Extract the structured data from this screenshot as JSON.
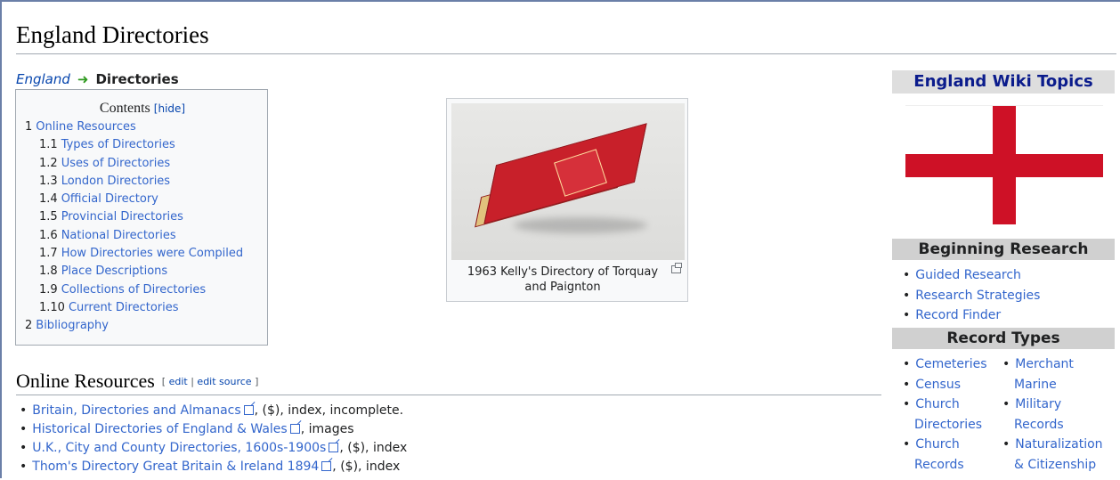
{
  "page": {
    "title": "England Directories",
    "breadcrumb": {
      "parent": "England",
      "current": "Directories"
    }
  },
  "toc": {
    "title": "Contents",
    "hide_label": "hide",
    "items": [
      {
        "num": "1",
        "label": "Online Resources",
        "level": 1
      },
      {
        "num": "1.1",
        "label": "Types of Directories",
        "level": 2
      },
      {
        "num": "1.2",
        "label": "Uses of Directories",
        "level": 2
      },
      {
        "num": "1.3",
        "label": "London Directories",
        "level": 2
      },
      {
        "num": "1.4",
        "label": "Official Directory",
        "level": 2
      },
      {
        "num": "1.5",
        "label": "Provincial Directories",
        "level": 2
      },
      {
        "num": "1.6",
        "label": "National Directories",
        "level": 2
      },
      {
        "num": "1.7",
        "label": "How Directories were Compiled",
        "level": 2
      },
      {
        "num": "1.8",
        "label": "Place Descriptions",
        "level": 2
      },
      {
        "num": "1.9",
        "label": "Collections of Directories",
        "level": 2
      },
      {
        "num": "1.10",
        "label": "Current Directories",
        "level": 2
      },
      {
        "num": "2",
        "label": "Bibliography",
        "level": 1
      }
    ]
  },
  "thumbnail": {
    "caption": "1963 Kelly's Directory of Torquay and Paignton",
    "icon": "magnify-icon"
  },
  "section": {
    "heading": "Online Resources",
    "edit_label": "edit",
    "edit_source_label": "edit source"
  },
  "resources": [
    {
      "link": "Britain, Directories and Almanacs",
      "suffix": ", ($), index, incomplete."
    },
    {
      "link": "Historical Directories of England & Wales",
      "suffix": ", images"
    },
    {
      "link": "U.K., City and County Directories, 1600s-1900s",
      "suffix": ", ($), index"
    },
    {
      "link": "Thom's Directory Great Britain & Ireland 1894",
      "suffix": ", ($), index"
    }
  ],
  "sidebar": {
    "title": "England Wiki Topics",
    "flag_colors": {
      "field": "#ffffff",
      "cross": "#ce1126"
    },
    "beginning_research": {
      "heading": "Beginning Research",
      "items": [
        "Guided Research",
        "Research Strategies",
        "Record Finder"
      ]
    },
    "record_types": {
      "heading": "Record Types",
      "col1": [
        {
          "line1": "Cemeteries",
          "line2": ""
        },
        {
          "line1": "Census",
          "line2": ""
        },
        {
          "line1": "Church",
          "line2": "Directories"
        },
        {
          "line1": "Church",
          "line2": "Records"
        }
      ],
      "col2": [
        {
          "line1": "Merchant",
          "line2": "Marine"
        },
        {
          "line1": "Military",
          "line2": "Records"
        },
        {
          "line1": "Naturalization",
          "line2": "& Citizenship"
        }
      ]
    }
  },
  "colors": {
    "link": "#3366cc",
    "frame": "#6b7fa8",
    "sidebar_title": "#0b1c8c"
  }
}
